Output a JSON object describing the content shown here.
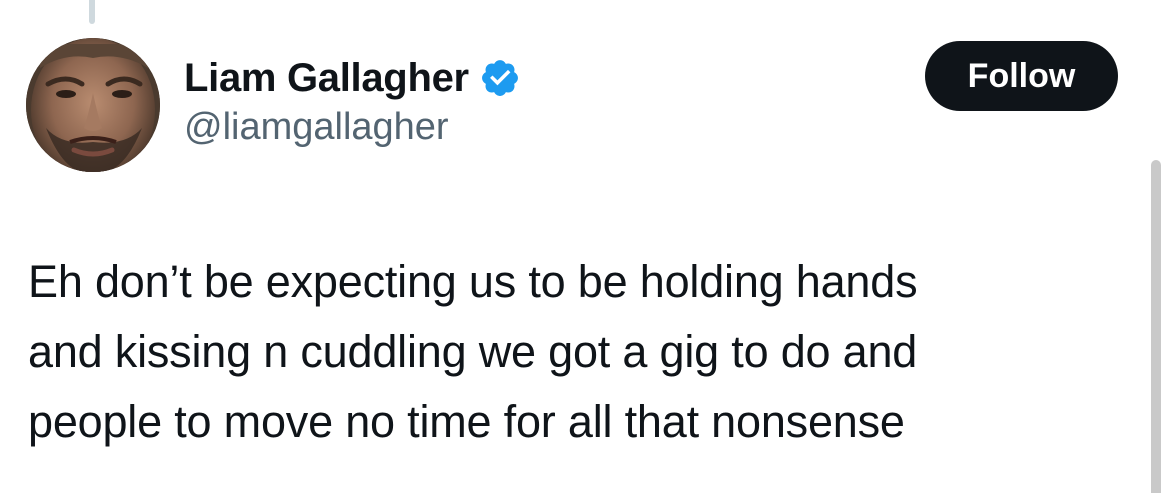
{
  "author": {
    "display_name": "Liam Gallagher",
    "handle": "@liamgallagher",
    "verified": true
  },
  "actions": {
    "follow_label": "Follow"
  },
  "tweet": {
    "lines": [
      "Eh don’t be expecting us to be holding hands",
      "and kissing n cuddling we got a gig to do and",
      "people to move no time for all that nonsense"
    ]
  },
  "icons": {
    "verified": "verified-badge-icon",
    "avatar": "profile-photo"
  },
  "colors": {
    "text_primary": "#0f1419",
    "text_secondary": "#536471",
    "verified_blue": "#1d9bf0",
    "follow_button_bg": "#0f1419",
    "follow_button_text": "#ffffff"
  }
}
